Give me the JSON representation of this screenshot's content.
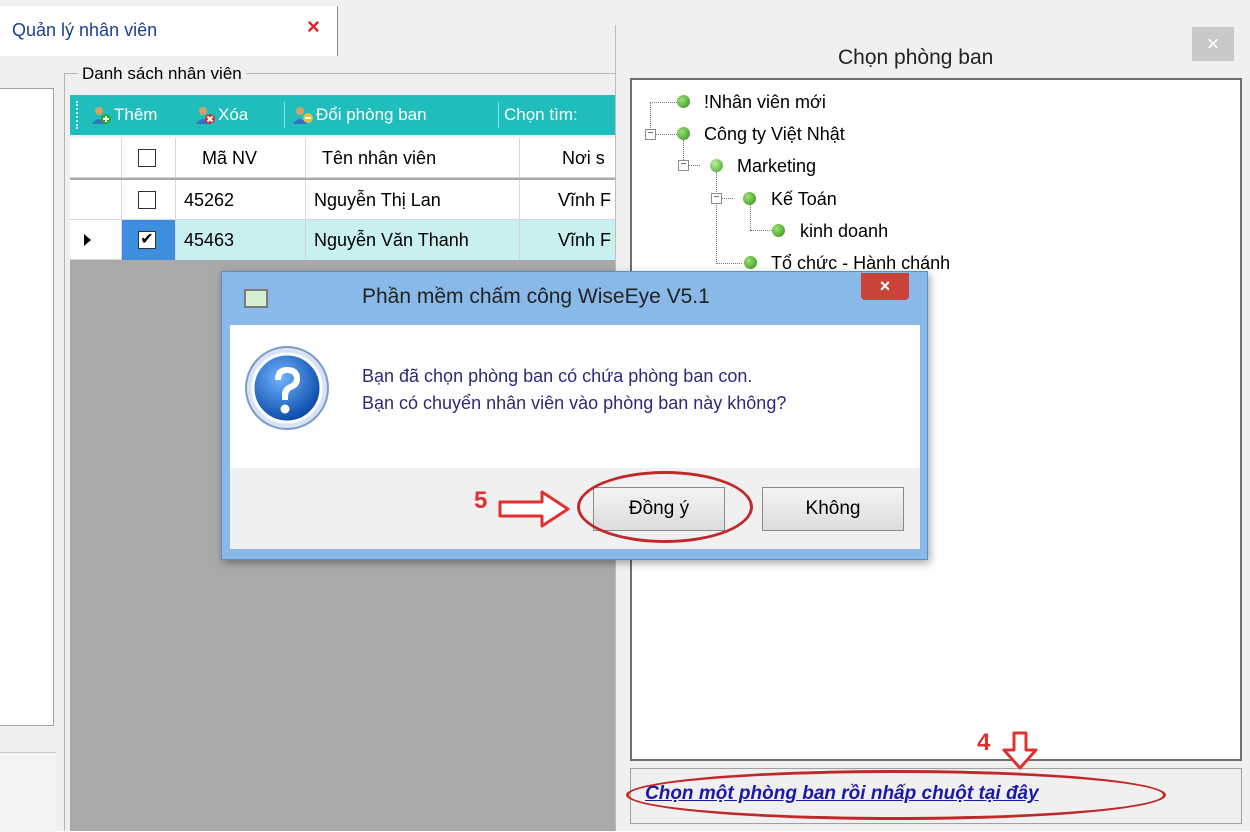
{
  "tab": {
    "title": "Quản lý nhân viên",
    "close": "×"
  },
  "employees": {
    "group_title": "Danh sách nhân viên",
    "toolbar": {
      "add": "Thêm",
      "delete": "Xóa",
      "change_dept": "Đổi phòng ban",
      "search": "Chọn tìm:"
    },
    "columns": [
      "Mã NV",
      "Tên nhân viên",
      "Nơi s"
    ],
    "rows": [
      {
        "checked": false,
        "id": "45262",
        "name": "Nguyễn Thị Lan",
        "place": "Vĩnh F",
        "current": false
      },
      {
        "checked": true,
        "id": "45463",
        "name": "Nguyễn Văn Thanh",
        "place": "Vĩnh F",
        "current": true
      }
    ]
  },
  "dept_dialog": {
    "title": "Chọn phòng ban",
    "close": "×",
    "tree": [
      "!Nhân viên mới",
      "Công ty Việt Nhật",
      "Marketing",
      "Kế Toán",
      "kinh doanh",
      "Tổ chức - Hành chánh"
    ],
    "footer_link": "Chọn một phòng ban rồi nhấp chuột tại đây",
    "annotation": "4"
  },
  "message_box": {
    "title": "Phần mềm chấm công WiseEye V5.1",
    "close": "×",
    "line1": "Bạn đã chọn phòng ban có chứa phòng ban con.",
    "line2": "Bạn có chuyển nhân viên vào phòng ban này không?",
    "yes": "Đồng ý",
    "no": "Không",
    "annotation": "5"
  },
  "colors": {
    "toolbar": "#20bdbd",
    "annotation": "#e03030",
    "selected_row": "#c8f0f0"
  }
}
